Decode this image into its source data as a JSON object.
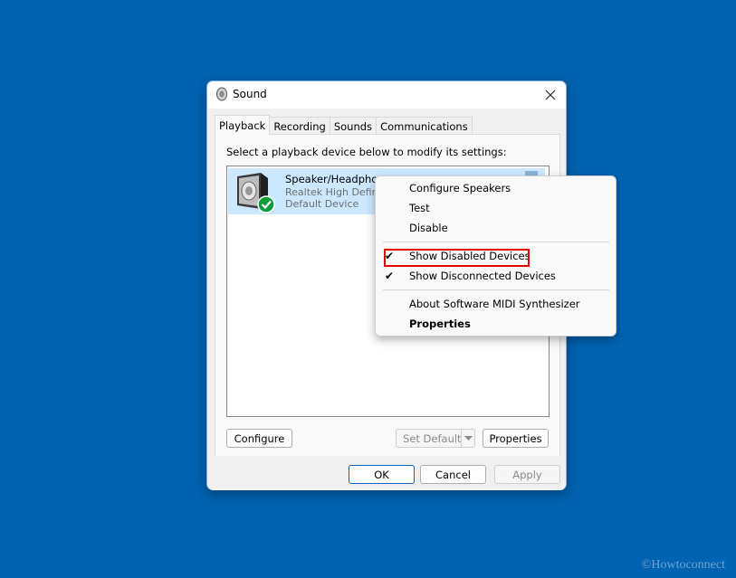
{
  "window": {
    "title": "Sound"
  },
  "tabs": [
    {
      "label": "Playback"
    },
    {
      "label": "Recording"
    },
    {
      "label": "Sounds"
    },
    {
      "label": "Communications"
    }
  ],
  "playback": {
    "instruction": "Select a playback device below to modify its settings:",
    "device": {
      "name": "Speaker/Headphon",
      "driver": "Realtek High Defin",
      "status": "Default Device"
    },
    "buttons": {
      "configure": "Configure",
      "set_default": "Set Default",
      "properties": "Properties"
    }
  },
  "footer": {
    "ok": "OK",
    "cancel": "Cancel",
    "apply": "Apply"
  },
  "context_menu": {
    "items": [
      {
        "label": "Configure Speakers",
        "checked": false
      },
      {
        "label": "Test",
        "checked": false
      },
      {
        "label": "Disable",
        "checked": false
      },
      {
        "label": "Show Disabled Devices",
        "checked": true
      },
      {
        "label": "Show Disconnected Devices",
        "checked": true
      },
      {
        "label": "About Software MIDI Synthesizer",
        "checked": false
      },
      {
        "label": "Properties",
        "checked": false
      }
    ],
    "check_glyph": "✔"
  },
  "watermark": "©Howtoconnect",
  "colors": {
    "desktop": "#0063b1",
    "selection": "#cce8ff",
    "highlight_box": "#e30000",
    "accent": "#0067c0"
  }
}
